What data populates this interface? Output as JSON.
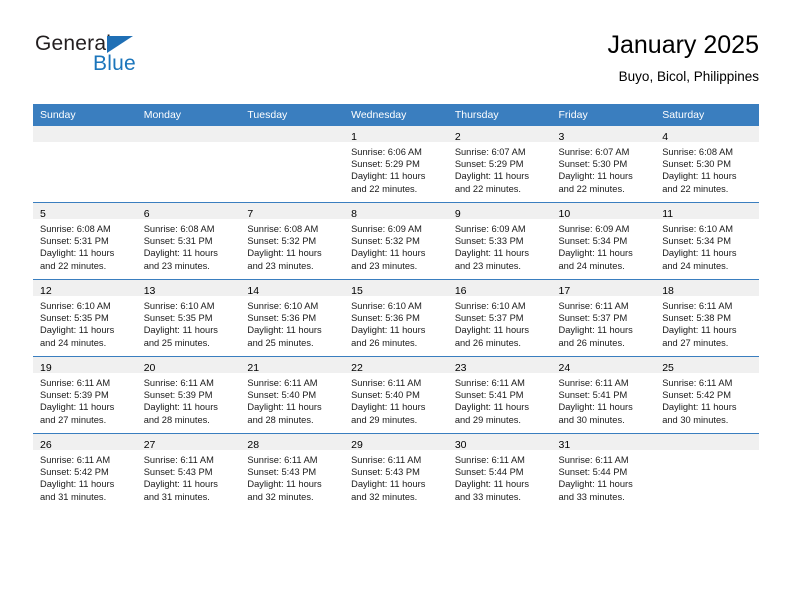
{
  "brand": {
    "name_top": "General",
    "name_bottom": "Blue",
    "triangle_color": "#1f6fb5",
    "blue_color": "#1b75bb"
  },
  "header": {
    "title": "January 2025",
    "subtitle": "Buyo, Bicol, Philippines"
  },
  "theme": {
    "header_row_bg": "#3a7ebf",
    "daynum_band_bg": "#f0f0f0",
    "cell_bg": "#ffffff",
    "separator": "#3a7ebf"
  },
  "weekday_headers": [
    "Sunday",
    "Monday",
    "Tuesday",
    "Wednesday",
    "Thursday",
    "Friday",
    "Saturday"
  ],
  "weeks": [
    [
      {
        "day": "",
        "sunrise": "",
        "sunset": "",
        "daylight1": "",
        "daylight2": ""
      },
      {
        "day": "",
        "sunrise": "",
        "sunset": "",
        "daylight1": "",
        "daylight2": ""
      },
      {
        "day": "",
        "sunrise": "",
        "sunset": "",
        "daylight1": "",
        "daylight2": ""
      },
      {
        "day": "1",
        "sunrise": "Sunrise: 6:06 AM",
        "sunset": "Sunset: 5:29 PM",
        "daylight1": "Daylight: 11 hours",
        "daylight2": "and 22 minutes."
      },
      {
        "day": "2",
        "sunrise": "Sunrise: 6:07 AM",
        "sunset": "Sunset: 5:29 PM",
        "daylight1": "Daylight: 11 hours",
        "daylight2": "and 22 minutes."
      },
      {
        "day": "3",
        "sunrise": "Sunrise: 6:07 AM",
        "sunset": "Sunset: 5:30 PM",
        "daylight1": "Daylight: 11 hours",
        "daylight2": "and 22 minutes."
      },
      {
        "day": "4",
        "sunrise": "Sunrise: 6:08 AM",
        "sunset": "Sunset: 5:30 PM",
        "daylight1": "Daylight: 11 hours",
        "daylight2": "and 22 minutes."
      }
    ],
    [
      {
        "day": "5",
        "sunrise": "Sunrise: 6:08 AM",
        "sunset": "Sunset: 5:31 PM",
        "daylight1": "Daylight: 11 hours",
        "daylight2": "and 22 minutes."
      },
      {
        "day": "6",
        "sunrise": "Sunrise: 6:08 AM",
        "sunset": "Sunset: 5:31 PM",
        "daylight1": "Daylight: 11 hours",
        "daylight2": "and 23 minutes."
      },
      {
        "day": "7",
        "sunrise": "Sunrise: 6:08 AM",
        "sunset": "Sunset: 5:32 PM",
        "daylight1": "Daylight: 11 hours",
        "daylight2": "and 23 minutes."
      },
      {
        "day": "8",
        "sunrise": "Sunrise: 6:09 AM",
        "sunset": "Sunset: 5:32 PM",
        "daylight1": "Daylight: 11 hours",
        "daylight2": "and 23 minutes."
      },
      {
        "day": "9",
        "sunrise": "Sunrise: 6:09 AM",
        "sunset": "Sunset: 5:33 PM",
        "daylight1": "Daylight: 11 hours",
        "daylight2": "and 23 minutes."
      },
      {
        "day": "10",
        "sunrise": "Sunrise: 6:09 AM",
        "sunset": "Sunset: 5:34 PM",
        "daylight1": "Daylight: 11 hours",
        "daylight2": "and 24 minutes."
      },
      {
        "day": "11",
        "sunrise": "Sunrise: 6:10 AM",
        "sunset": "Sunset: 5:34 PM",
        "daylight1": "Daylight: 11 hours",
        "daylight2": "and 24 minutes."
      }
    ],
    [
      {
        "day": "12",
        "sunrise": "Sunrise: 6:10 AM",
        "sunset": "Sunset: 5:35 PM",
        "daylight1": "Daylight: 11 hours",
        "daylight2": "and 24 minutes."
      },
      {
        "day": "13",
        "sunrise": "Sunrise: 6:10 AM",
        "sunset": "Sunset: 5:35 PM",
        "daylight1": "Daylight: 11 hours",
        "daylight2": "and 25 minutes."
      },
      {
        "day": "14",
        "sunrise": "Sunrise: 6:10 AM",
        "sunset": "Sunset: 5:36 PM",
        "daylight1": "Daylight: 11 hours",
        "daylight2": "and 25 minutes."
      },
      {
        "day": "15",
        "sunrise": "Sunrise: 6:10 AM",
        "sunset": "Sunset: 5:36 PM",
        "daylight1": "Daylight: 11 hours",
        "daylight2": "and 26 minutes."
      },
      {
        "day": "16",
        "sunrise": "Sunrise: 6:10 AM",
        "sunset": "Sunset: 5:37 PM",
        "daylight1": "Daylight: 11 hours",
        "daylight2": "and 26 minutes."
      },
      {
        "day": "17",
        "sunrise": "Sunrise: 6:11 AM",
        "sunset": "Sunset: 5:37 PM",
        "daylight1": "Daylight: 11 hours",
        "daylight2": "and 26 minutes."
      },
      {
        "day": "18",
        "sunrise": "Sunrise: 6:11 AM",
        "sunset": "Sunset: 5:38 PM",
        "daylight1": "Daylight: 11 hours",
        "daylight2": "and 27 minutes."
      }
    ],
    [
      {
        "day": "19",
        "sunrise": "Sunrise: 6:11 AM",
        "sunset": "Sunset: 5:39 PM",
        "daylight1": "Daylight: 11 hours",
        "daylight2": "and 27 minutes."
      },
      {
        "day": "20",
        "sunrise": "Sunrise: 6:11 AM",
        "sunset": "Sunset: 5:39 PM",
        "daylight1": "Daylight: 11 hours",
        "daylight2": "and 28 minutes."
      },
      {
        "day": "21",
        "sunrise": "Sunrise: 6:11 AM",
        "sunset": "Sunset: 5:40 PM",
        "daylight1": "Daylight: 11 hours",
        "daylight2": "and 28 minutes."
      },
      {
        "day": "22",
        "sunrise": "Sunrise: 6:11 AM",
        "sunset": "Sunset: 5:40 PM",
        "daylight1": "Daylight: 11 hours",
        "daylight2": "and 29 minutes."
      },
      {
        "day": "23",
        "sunrise": "Sunrise: 6:11 AM",
        "sunset": "Sunset: 5:41 PM",
        "daylight1": "Daylight: 11 hours",
        "daylight2": "and 29 minutes."
      },
      {
        "day": "24",
        "sunrise": "Sunrise: 6:11 AM",
        "sunset": "Sunset: 5:41 PM",
        "daylight1": "Daylight: 11 hours",
        "daylight2": "and 30 minutes."
      },
      {
        "day": "25",
        "sunrise": "Sunrise: 6:11 AM",
        "sunset": "Sunset: 5:42 PM",
        "daylight1": "Daylight: 11 hours",
        "daylight2": "and 30 minutes."
      }
    ],
    [
      {
        "day": "26",
        "sunrise": "Sunrise: 6:11 AM",
        "sunset": "Sunset: 5:42 PM",
        "daylight1": "Daylight: 11 hours",
        "daylight2": "and 31 minutes."
      },
      {
        "day": "27",
        "sunrise": "Sunrise: 6:11 AM",
        "sunset": "Sunset: 5:43 PM",
        "daylight1": "Daylight: 11 hours",
        "daylight2": "and 31 minutes."
      },
      {
        "day": "28",
        "sunrise": "Sunrise: 6:11 AM",
        "sunset": "Sunset: 5:43 PM",
        "daylight1": "Daylight: 11 hours",
        "daylight2": "and 32 minutes."
      },
      {
        "day": "29",
        "sunrise": "Sunrise: 6:11 AM",
        "sunset": "Sunset: 5:43 PM",
        "daylight1": "Daylight: 11 hours",
        "daylight2": "and 32 minutes."
      },
      {
        "day": "30",
        "sunrise": "Sunrise: 6:11 AM",
        "sunset": "Sunset: 5:44 PM",
        "daylight1": "Daylight: 11 hours",
        "daylight2": "and 33 minutes."
      },
      {
        "day": "31",
        "sunrise": "Sunrise: 6:11 AM",
        "sunset": "Sunset: 5:44 PM",
        "daylight1": "Daylight: 11 hours",
        "daylight2": "and 33 minutes."
      },
      {
        "day": "",
        "sunrise": "",
        "sunset": "",
        "daylight1": "",
        "daylight2": ""
      }
    ]
  ]
}
